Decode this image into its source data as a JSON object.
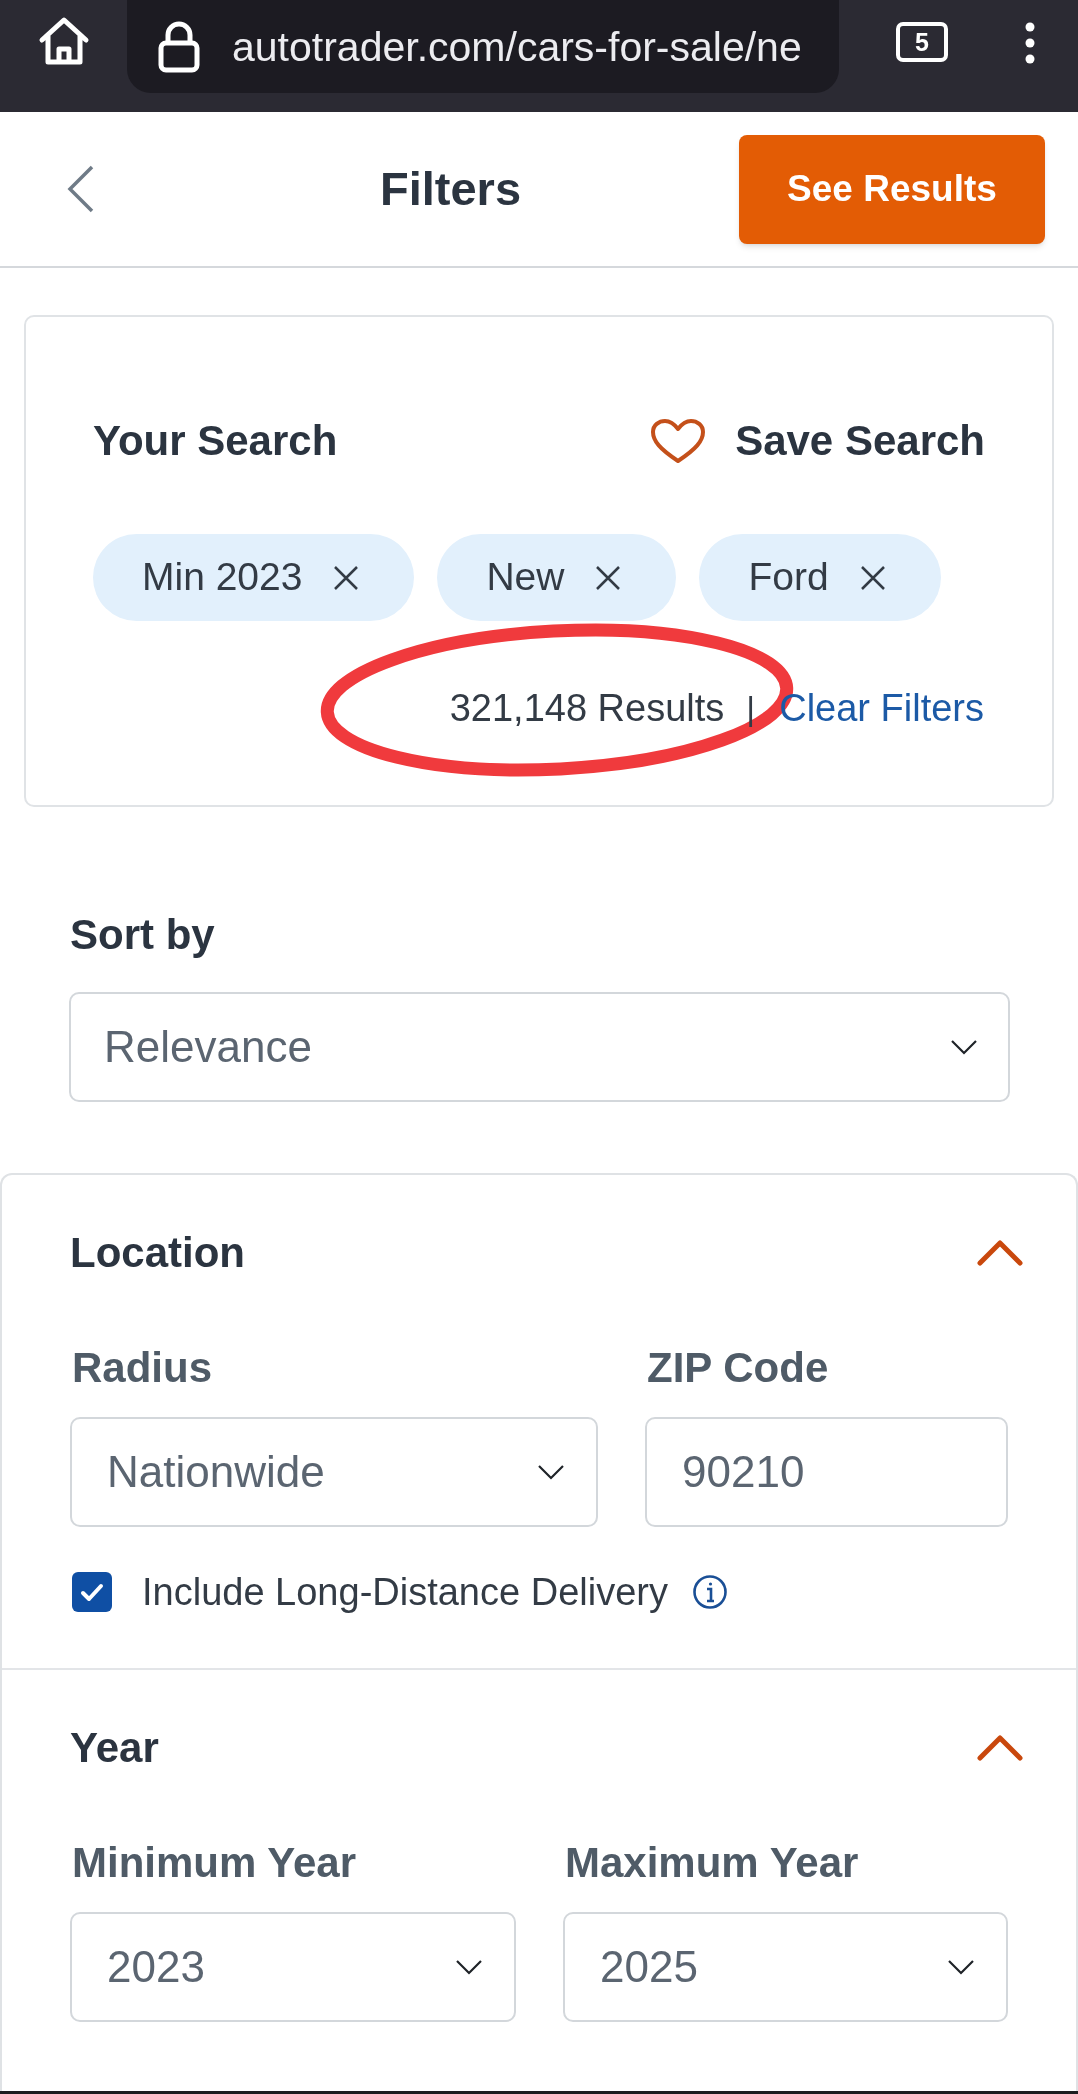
{
  "browser": {
    "url": "autotrader.com/cars-for-sale/ne",
    "tab_count": "5"
  },
  "header": {
    "title": "Filters",
    "action": "See Results"
  },
  "your_search": {
    "title": "Your Search",
    "save_label": "Save Search",
    "chips": [
      {
        "label": "Min 2023"
      },
      {
        "label": "New"
      },
      {
        "label": "Ford"
      }
    ],
    "results": {
      "text": "321,148 Results",
      "circled": true
    },
    "separator": "|",
    "clear_label": "Clear Filters"
  },
  "sort": {
    "label": "Sort by",
    "value": "Relevance"
  },
  "sections": [
    {
      "title": "Location",
      "expanded": true,
      "fields": [
        {
          "kind": "select",
          "label": "Radius",
          "value": "Nationwide"
        },
        {
          "kind": "text",
          "label": "ZIP Code",
          "value": "90210"
        }
      ],
      "checkbox": {
        "label": "Include Long-Distance Delivery",
        "checked": true
      }
    },
    {
      "title": "Year",
      "expanded": true,
      "fields": [
        {
          "kind": "select",
          "label": "Minimum Year",
          "value": "2023"
        },
        {
          "kind": "select",
          "label": "Maximum Year",
          "value": "2025"
        }
      ]
    }
  ]
}
